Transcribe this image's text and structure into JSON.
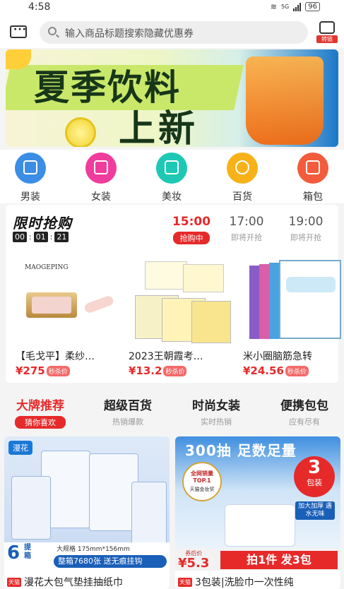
{
  "status": {
    "time": "4:58",
    "network": "5G",
    "battery": "96"
  },
  "header": {
    "search_placeholder": "输入商品标题搜索隐藏优惠券",
    "transfer_label": "转链"
  },
  "banner": {
    "line1": "夏季饮料",
    "line2": "上新"
  },
  "categories": [
    {
      "label": "男装",
      "color": "#3b8de6"
    },
    {
      "label": "女装",
      "color": "#f03c9c"
    },
    {
      "label": "美妆",
      "color": "#1fc8b4"
    },
    {
      "label": "百货",
      "color": "#f7b21a"
    },
    {
      "label": "箱包",
      "color": "#f25c3c"
    }
  ],
  "flash_sale": {
    "title": "限时抢购",
    "countdown": [
      "00",
      "01",
      "21"
    ],
    "slots": [
      {
        "time": "15:00",
        "status": "抢购中"
      },
      {
        "time": "17:00",
        "status": "即将开抢"
      },
      {
        "time": "19:00",
        "status": "即将开抢"
      }
    ],
    "products": [
      {
        "brand": "MAOGEPING",
        "name": "【毛戈平】柔纱…",
        "price": "¥275",
        "tag": "秒杀价"
      },
      {
        "name": "2023王朝霞考…",
        "price": "¥13.2",
        "tag": "秒杀价"
      },
      {
        "name": "米小圈脑筋急转",
        "price": "¥24.56",
        "tag": "秒杀价"
      }
    ]
  },
  "tabs": [
    {
      "title": "大牌推荐",
      "sub": "猜你喜欢"
    },
    {
      "title": "超级百货",
      "sub": "热销爆款"
    },
    {
      "title": "时尚女装",
      "sub": "实时热销"
    },
    {
      "title": "便携包包",
      "sub": "应有尽有"
    }
  ],
  "cards": [
    {
      "brand": "漫花",
      "qty": "6",
      "qty_unit": "提箱",
      "promo": "整箱7680张  送无痕挂钩",
      "spec": "大规格 175mm*156mm",
      "store_tag": "天猫",
      "name": "漫花大包气垫挂抽纸巾"
    },
    {
      "headline": "300抽  足数足量",
      "badge": "全网销量 TOP.1",
      "badge_sub": "天猫金妆奖",
      "pack_num": "3",
      "pack_unit": "包装",
      "feature": "加大加厚 遇水无味",
      "price_label": "券后价",
      "price": "¥5.3",
      "promo": "拍1件 发3包",
      "store_tag": "天猫",
      "name": "3包装|洗脸巾一次性纯"
    }
  ]
}
